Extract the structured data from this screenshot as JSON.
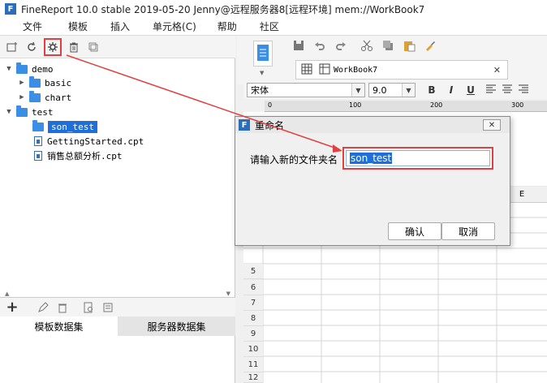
{
  "window": {
    "title": "FineReport 10.0 stable 2019-05-20 Jenny@远程服务器8[远程环境]    mem://WorkBook7",
    "logo": "F"
  },
  "menu": [
    "文件",
    "模板",
    "插入",
    "单元格(C)",
    "帮助",
    "社区"
  ],
  "tree": {
    "items": [
      {
        "label": "demo",
        "type": "folder",
        "expanded": true
      },
      {
        "label": "basic",
        "type": "folder",
        "expanded": false
      },
      {
        "label": "chart",
        "type": "folder",
        "expanded": false
      },
      {
        "label": "test",
        "type": "folder",
        "expanded": true
      },
      {
        "label": "son_test",
        "type": "folder",
        "selected": true
      },
      {
        "label": "GettingStarted.cpt",
        "type": "file"
      },
      {
        "label": "销售总额分析.cpt",
        "type": "file"
      }
    ]
  },
  "bottom_tabs": [
    "模板数据集",
    "服务器数据集"
  ],
  "editor_tab": "WorkBook7",
  "format": {
    "font": "宋体",
    "size": "9.0",
    "bold": "B",
    "italic": "I",
    "underline": "U"
  },
  "ruler": [
    "0",
    "100",
    "200",
    "300"
  ],
  "column_header_e": "E",
  "rows": [
    "5",
    "6",
    "7",
    "8",
    "9",
    "10",
    "11",
    "12"
  ],
  "dialog": {
    "title": "重命名",
    "prompt": "请输入新的文件夹名",
    "value": "son_test",
    "ok": "确认",
    "cancel": "取消",
    "close": "✕"
  },
  "colors": {
    "accent": "#1e6fd9",
    "highlight": "#e04040"
  }
}
